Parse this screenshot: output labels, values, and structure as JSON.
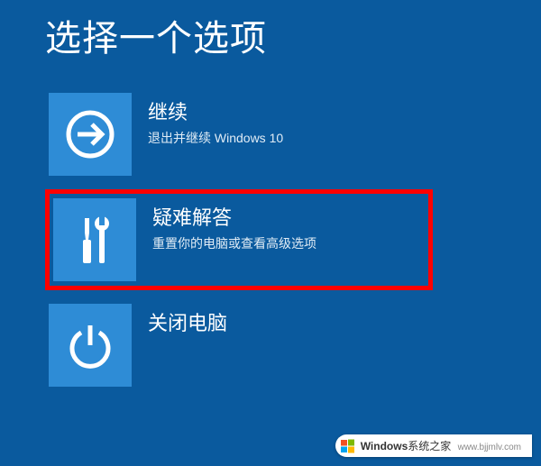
{
  "page": {
    "title": "选择一个选项"
  },
  "options": [
    {
      "icon": "arrow-right",
      "title": "继续",
      "subtitle": "退出并继续 Windows 10",
      "highlighted": false
    },
    {
      "icon": "tools",
      "title": "疑难解答",
      "subtitle": "重置你的电脑或查看高级选项",
      "highlighted": true
    },
    {
      "icon": "power",
      "title": "关闭电脑",
      "subtitle": "",
      "highlighted": false
    }
  ],
  "watermark": {
    "brand": "Windows",
    "suffix": "系统之家",
    "url": "www.bjjmlv.com"
  },
  "colors": {
    "background": "#0a5a9e",
    "tile": "#2e8cd6",
    "highlight_border": "#ff0000"
  }
}
